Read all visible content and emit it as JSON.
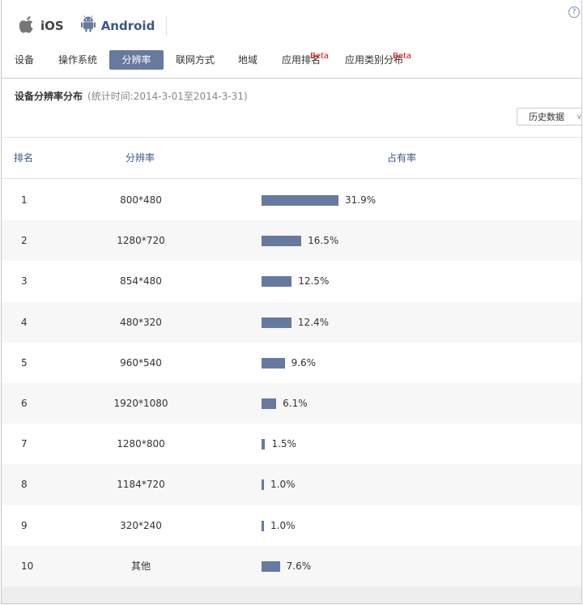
{
  "platforms": [
    {
      "label": "iOS",
      "icon": "apple-icon"
    },
    {
      "label": "Android",
      "icon": "android-icon"
    }
  ],
  "help_symbol": "?",
  "tabs": [
    {
      "label": "设备",
      "active": false
    },
    {
      "label": "操作系统",
      "active": false
    },
    {
      "label": "分辨率",
      "active": true
    },
    {
      "label": "联网方式",
      "active": false
    },
    {
      "label": "地域",
      "active": false
    },
    {
      "label": "应用排名",
      "active": false,
      "badge": "Beta"
    },
    {
      "label": "应用类别分布",
      "active": false,
      "badge": "Beta"
    }
  ],
  "section": {
    "title": "设备分辨率分布",
    "period": "(统计时间:2014-3-01至2014-3-31)"
  },
  "history_button": {
    "label": "历史数据"
  },
  "table": {
    "headers": {
      "rank": "排名",
      "resolution": "分辨率",
      "share": "占有率"
    },
    "rows": [
      {
        "rank": "1",
        "resolution": "800*480",
        "share_pct": 31.9,
        "share_label": "31.9%"
      },
      {
        "rank": "2",
        "resolution": "1280*720",
        "share_pct": 16.5,
        "share_label": "16.5%"
      },
      {
        "rank": "3",
        "resolution": "854*480",
        "share_pct": 12.5,
        "share_label": "12.5%"
      },
      {
        "rank": "4",
        "resolution": "480*320",
        "share_pct": 12.4,
        "share_label": "12.4%"
      },
      {
        "rank": "5",
        "resolution": "960*540",
        "share_pct": 9.6,
        "share_label": "9.6%"
      },
      {
        "rank": "6",
        "resolution": "1920*1080",
        "share_pct": 6.1,
        "share_label": "6.1%"
      },
      {
        "rank": "7",
        "resolution": "1280*800",
        "share_pct": 1.5,
        "share_label": "1.5%"
      },
      {
        "rank": "8",
        "resolution": "1184*720",
        "share_pct": 1.0,
        "share_label": "1.0%"
      },
      {
        "rank": "9",
        "resolution": "320*240",
        "share_pct": 1.0,
        "share_label": "1.0%"
      },
      {
        "rank": "10",
        "resolution": "其他",
        "share_pct": 7.6,
        "share_label": "7.6%"
      }
    ]
  },
  "colors": {
    "accent": "#66799f",
    "bar": "#6679a1",
    "beta": "#e00000",
    "header_text": "#3b5786"
  }
}
